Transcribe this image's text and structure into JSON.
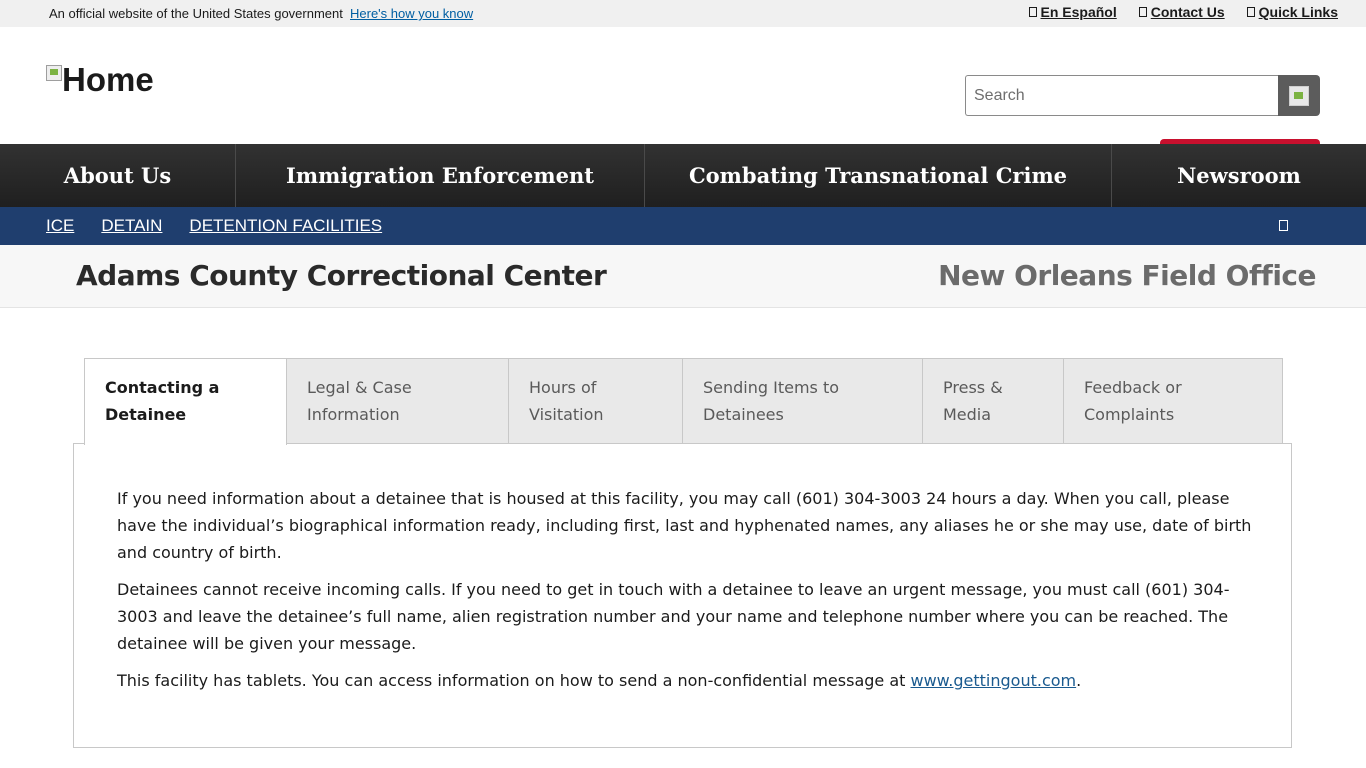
{
  "gov_banner": {
    "text": "An official website of the United States government",
    "link": "Here's how you know"
  },
  "utility_links": [
    {
      "label": "En Español"
    },
    {
      "label": "Contact Us"
    },
    {
      "label": "Quick Links"
    }
  ],
  "header": {
    "logo_alt": "Home",
    "search_placeholder": "Search"
  },
  "main_nav": [
    {
      "label": "About Us"
    },
    {
      "label": "Immigration Enforcement"
    },
    {
      "label": "Combating Transnational Crime"
    },
    {
      "label": "Newsroom"
    }
  ],
  "breadcrumb": [
    {
      "label": "ICE"
    },
    {
      "label": "DETAIN"
    },
    {
      "label": "DETENTION FACILITIES"
    }
  ],
  "facility": {
    "name": "Adams County Correctional Center",
    "field_office": "New Orleans Field Office"
  },
  "tabs": [
    {
      "line1": "Contacting a",
      "line2": "Detainee"
    },
    {
      "line1": "Legal & Case",
      "line2": "Information"
    },
    {
      "line1": "Hours of",
      "line2": "Visitation"
    },
    {
      "line1": "Sending Items to",
      "line2": "Detainees"
    },
    {
      "line1": "Press &",
      "line2": "Media"
    },
    {
      "line1": "Feedback or",
      "line2": "Complaints"
    }
  ],
  "content": {
    "p1": "If you need information about a detainee that is housed at this facility, you may call (601) 304-3003 24 hours a day. When you call, please have the individual’s biographical information ready, including first, last and hyphenated names, any aliases he or she may use, date of birth and country of birth.",
    "p2": "Detainees cannot receive incoming calls. If you need to get in touch with a detainee to leave an urgent message, you must call (601) 304-3003 and leave the detainee’s full name, alien registration number and your name and telephone number where you can be reached. The detainee will be given your message.",
    "p3_prefix": "This facility has tablets. You can access information on how to send a non-confidential message at ",
    "p3_link": "www.gettingout.com",
    "p3_suffix": "."
  },
  "colors": {
    "nav_bg": "#262626",
    "crumb_bg": "#1f3e6e",
    "accent_red": "#c8102e",
    "link_blue": "#005ea2"
  }
}
